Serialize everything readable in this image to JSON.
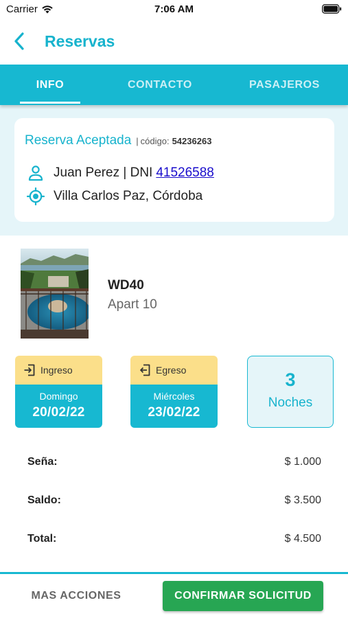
{
  "status_bar": {
    "carrier": "Carrier",
    "time": "7:06 AM"
  },
  "header": {
    "title": "Reservas",
    "back_icon": "chevron-left-icon"
  },
  "tabs": [
    {
      "label": "INFO",
      "active": true
    },
    {
      "label": "CONTACTO",
      "active": false
    },
    {
      "label": "PASAJEROS",
      "active": false
    }
  ],
  "reservation": {
    "status": "Reserva Aceptada",
    "code_separator": "|",
    "code_label": "código:",
    "code_value": "54236263",
    "guest_name": "Juan Perez | DNI",
    "dni": "41526588",
    "location": "Villa Carlos Paz, Córdoba"
  },
  "property": {
    "code": "WD40",
    "name": "Apart 10"
  },
  "dates": {
    "checkin": {
      "label": "Ingreso",
      "day": "Domingo",
      "date": "20/02/22",
      "icon": "login-icon"
    },
    "checkout": {
      "label": "Egreso",
      "day": "Miércoles",
      "date": "23/02/22",
      "icon": "logout-icon"
    },
    "nights": {
      "count": "3",
      "label": "Noches"
    }
  },
  "payments": [
    {
      "label": "Seña:",
      "value": "$ 1.000"
    },
    {
      "label": "Saldo:",
      "value": "$ 3.500"
    },
    {
      "label": "Total:",
      "value": "$ 4.500"
    }
  ],
  "actions": {
    "more": "MAS ACCIONES",
    "confirm": "CONFIRMAR SOLICITUD"
  },
  "colors": {
    "primary": "#17b8d1",
    "accent_yellow": "#fbdf8a",
    "confirm_green": "#27a653",
    "light_bg": "#e5f5f9",
    "link": "#1a0dcc"
  }
}
